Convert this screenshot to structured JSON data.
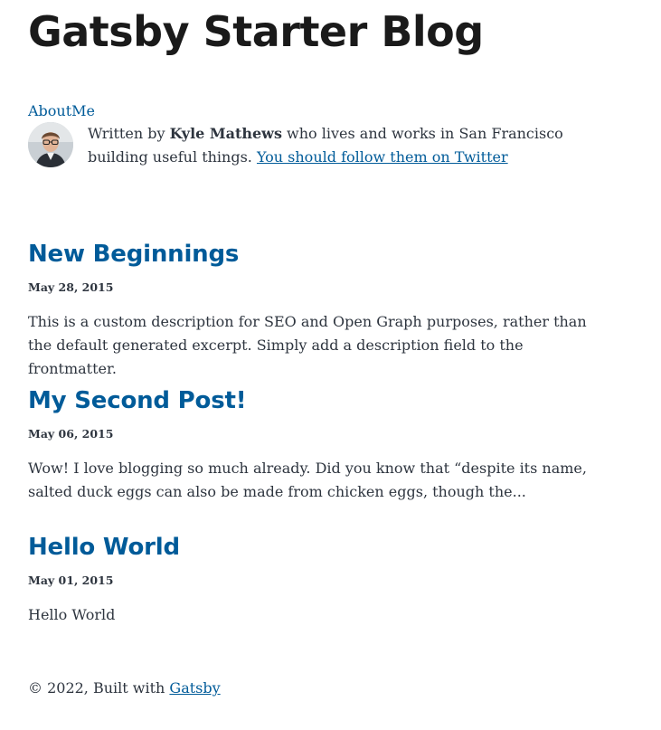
{
  "site": {
    "title": "Gatsby Starter Blog",
    "about_link": "AboutMe"
  },
  "bio": {
    "prefix": "Written by ",
    "author": "Kyle Mathews",
    "middle": " who lives and works in San Francisco building useful things. ",
    "twitter_link": "You should follow them on Twitter"
  },
  "posts": [
    {
      "title": "New Beginnings",
      "date": "May 28, 2015",
      "description": "This is a custom description for SEO and Open Graph purposes, rather than the default generated excerpt. Simply add a description field to the frontmatter."
    },
    {
      "title": "My Second Post!",
      "date": "May 06, 2015",
      "description": "Wow! I love blogging so much already. Did you know that “despite its name, salted duck eggs can also be made from chicken eggs, though the..."
    },
    {
      "title": "Hello World",
      "date": "May 01, 2015",
      "description": "Hello World"
    }
  ],
  "footer": {
    "text": "© 2022, Built with ",
    "link": "Gatsby"
  },
  "colors": {
    "link": "#005b99",
    "text": "#2e353f",
    "heading": "#1a1a1a"
  }
}
